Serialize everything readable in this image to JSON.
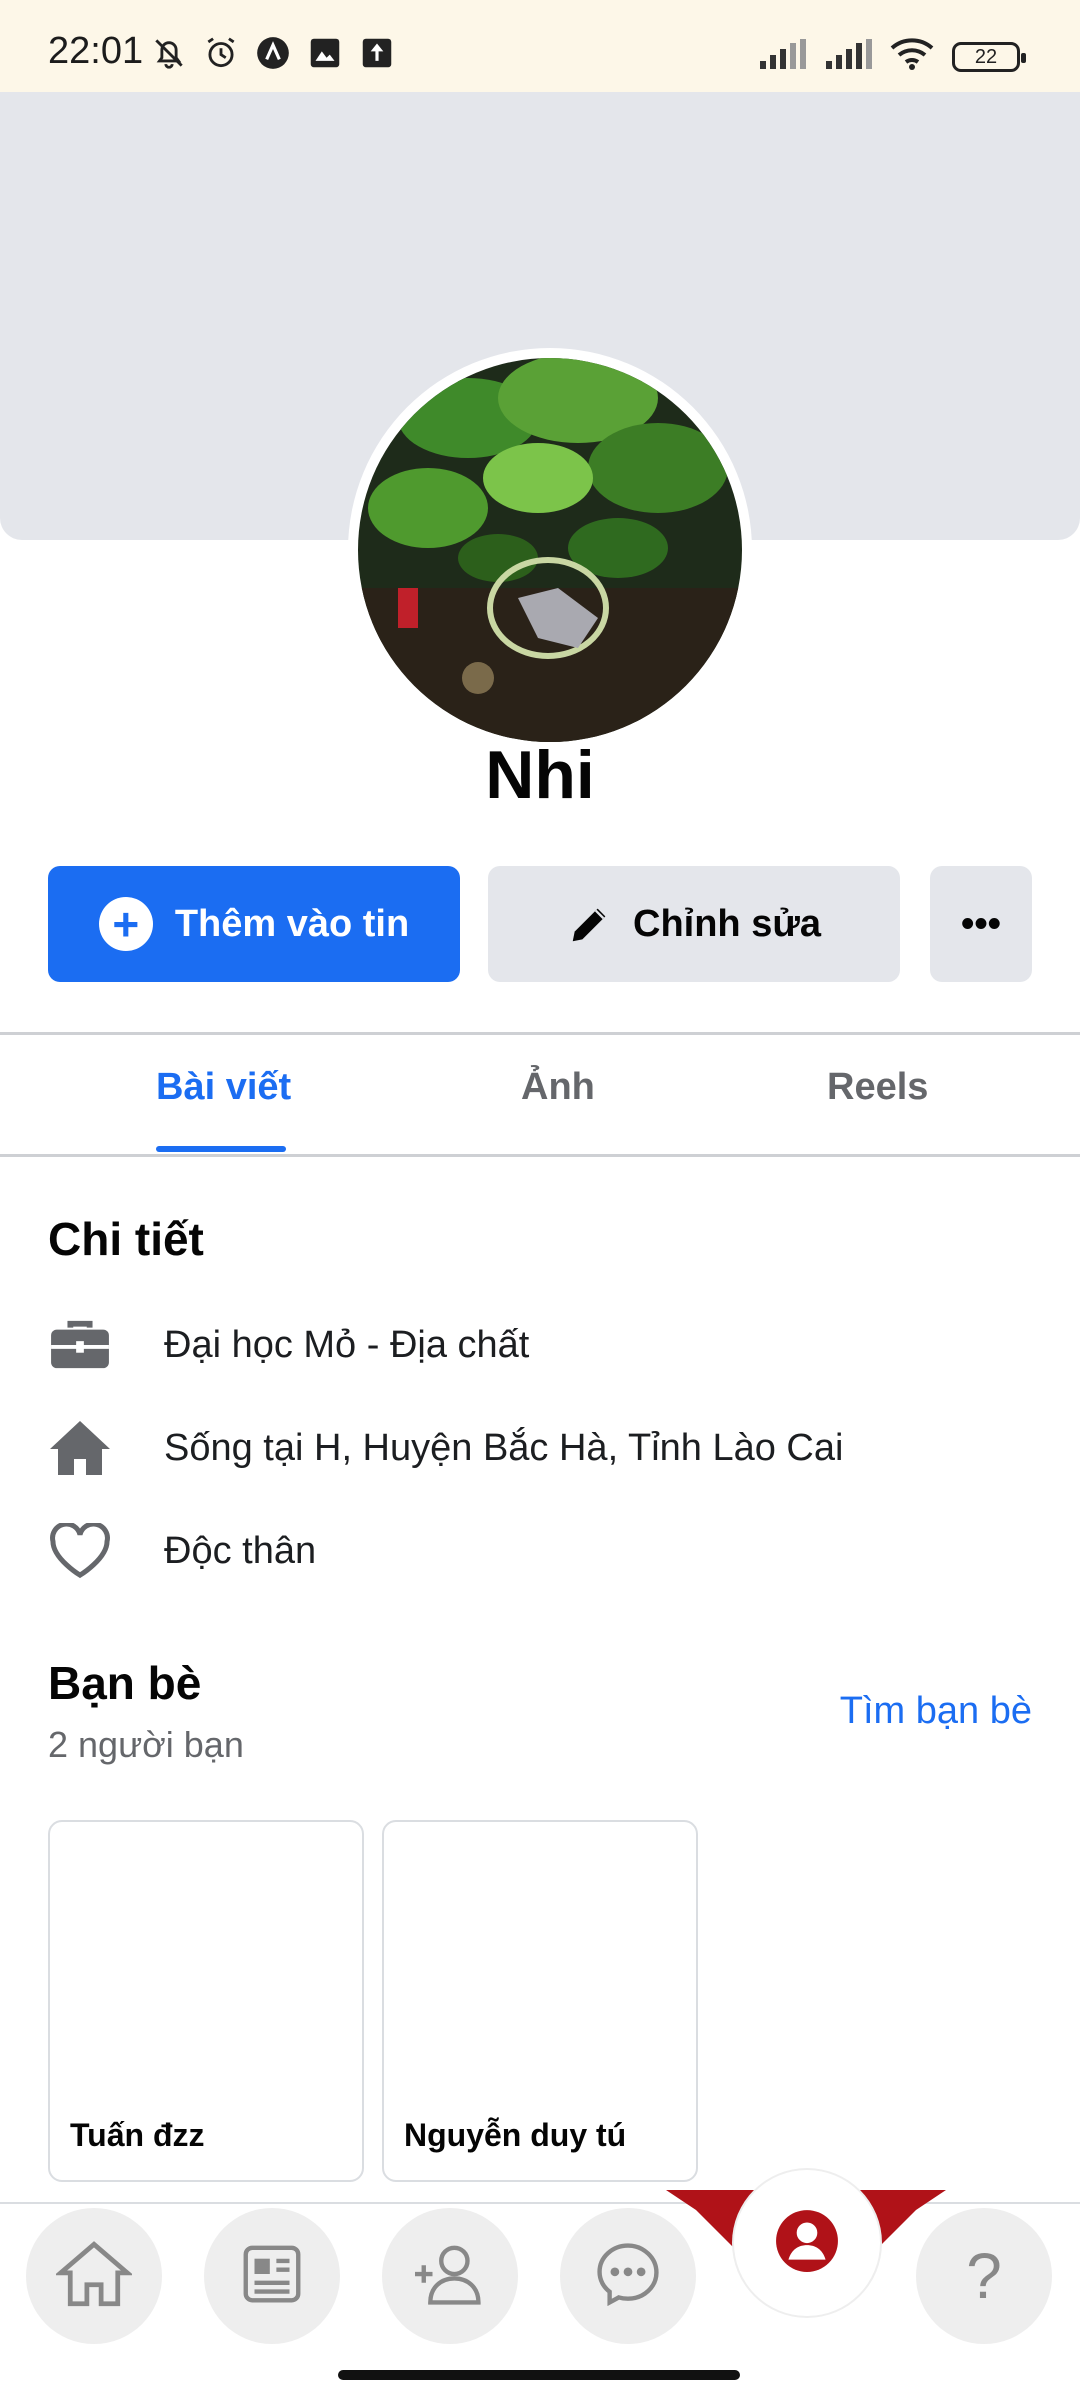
{
  "status_bar": {
    "time": "22:01",
    "battery": "22",
    "icons": [
      "mute-bell-icon",
      "alarm-icon",
      "app-notification-icon",
      "image-notification-icon",
      "upload-icon",
      "signal-icon",
      "signal-icon",
      "wifi-icon",
      "battery-icon"
    ]
  },
  "profile": {
    "name": "Nhi"
  },
  "actions": {
    "add_story": "Thêm vào tin",
    "edit": "Chỉnh sửa",
    "more": "•••"
  },
  "tabs": {
    "posts": "Bài viết",
    "photos": "Ảnh",
    "reels": "Reels",
    "active": "posts"
  },
  "details": {
    "title": "Chi tiết",
    "items": [
      {
        "icon": "briefcase-icon",
        "text": "Đại học Mỏ - Địa chất"
      },
      {
        "icon": "home-icon",
        "text": "Sống tại H, Huyện Bắc Hà, Tỉnh Lào Cai"
      },
      {
        "icon": "heart-icon",
        "text": "Độc thân"
      }
    ]
  },
  "friends": {
    "title": "Bạn bè",
    "count": "2 người bạn",
    "find_link": "Tìm bạn bè",
    "list": [
      {
        "name": "Tuấn đzz"
      },
      {
        "name": "Nguyễn duy tú"
      }
    ]
  },
  "bottom_nav": {
    "items": [
      "home-icon",
      "news-feed-icon",
      "add-friend-icon",
      "messenger-icon",
      "profile-icon",
      "help-icon"
    ],
    "active": "profile-icon",
    "help_label": "?"
  },
  "colors": {
    "accent": "#1b6df2",
    "secondary_text": "#65676b",
    "button_grey": "#e4e6eb",
    "nav_active_ring": "#b01218"
  }
}
